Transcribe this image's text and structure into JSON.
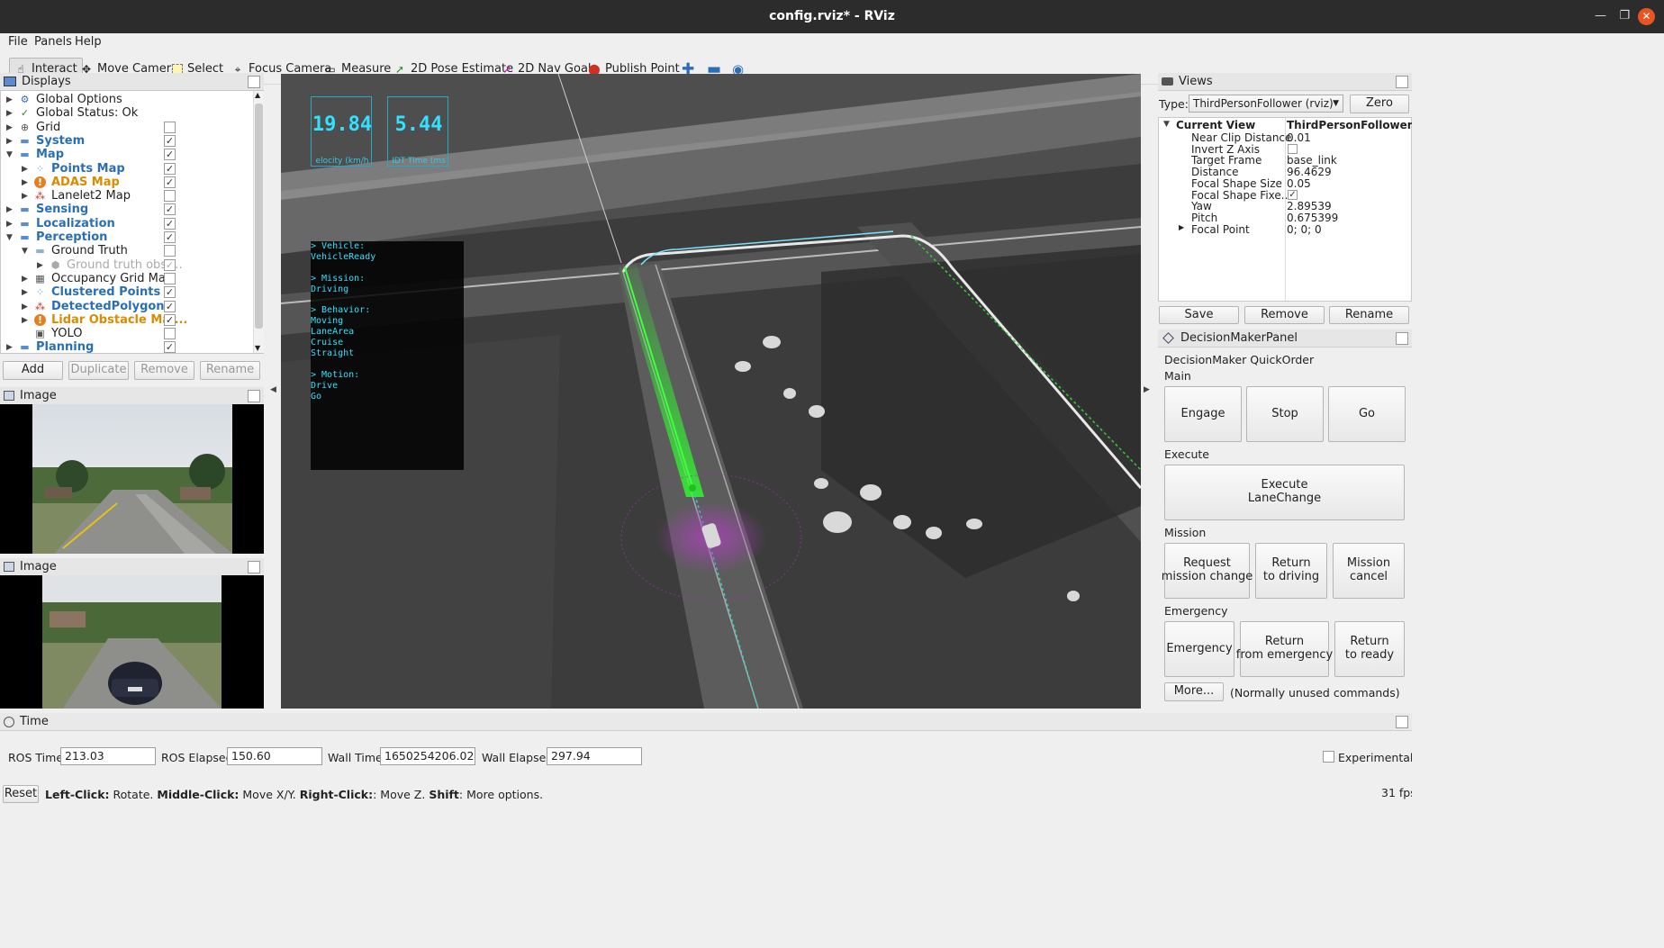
{
  "window": {
    "title": "config.rviz* - RViz"
  },
  "menu": [
    "File",
    "Panels",
    "Help"
  ],
  "toolbar": {
    "tools": [
      {
        "label": "Interact",
        "icon": "interact-icon"
      },
      {
        "label": "Move Camera",
        "icon": "move-camera-icon"
      },
      {
        "label": "Select",
        "icon": "select-icon"
      },
      {
        "label": "Focus Camera",
        "icon": "focus-camera-icon"
      },
      {
        "label": "Measure",
        "icon": "measure-icon"
      },
      {
        "label": "2D Pose Estimate",
        "icon": "pose-estimate-icon"
      },
      {
        "label": "2D Nav Goal",
        "icon": "nav-goal-icon"
      },
      {
        "label": "Publish Point",
        "icon": "publish-point-icon"
      }
    ]
  },
  "displays": {
    "title": "Displays",
    "items": [
      {
        "label": "Global Options"
      },
      {
        "label": "Global Status: Ok"
      },
      {
        "label": "Grid",
        "checked": false
      },
      {
        "label": "System",
        "checked": true
      },
      {
        "label": "Map",
        "checked": true
      },
      {
        "label": "Points Map",
        "checked": true
      },
      {
        "label": "ADAS Map",
        "checked": true
      },
      {
        "label": "Lanelet2 Map",
        "checked": false
      },
      {
        "label": "Sensing",
        "checked": true
      },
      {
        "label": "Localization",
        "checked": true
      },
      {
        "label": "Perception",
        "checked": true
      },
      {
        "label": "Ground Truth",
        "checked": false
      },
      {
        "label": "Ground truth obst...",
        "checked": true
      },
      {
        "label": "Occupancy Grid Map",
        "checked": false
      },
      {
        "label": "Clustered Points",
        "checked": true
      },
      {
        "label": "DetectedPolygons",
        "checked": true
      },
      {
        "label": "Lidar Obstacle Mar...",
        "checked": true
      },
      {
        "label": "YOLO",
        "checked": false
      },
      {
        "label": "Planning",
        "checked": true
      }
    ],
    "buttons": {
      "add": "Add",
      "duplicate": "Duplicate",
      "remove": "Remove",
      "rename": "Rename"
    }
  },
  "image_panels": [
    {
      "title": "Image"
    },
    {
      "title": "Image"
    }
  ],
  "overlay": {
    "velocity_value": "19.84",
    "velocity_label": "elocity (km/h",
    "time_value": "5.44",
    "time_label": "IDT Time (ms",
    "state_lines": [
      "> Vehicle:",
      "VehicleReady",
      "",
      "> Mission:",
      "Driving",
      "",
      "> Behavior:",
      "Moving",
      "LaneArea",
      "Cruise",
      "Straight",
      "",
      "> Motion:",
      "Drive",
      "Go"
    ]
  },
  "views": {
    "title": "Views",
    "type_label": "Type:",
    "type_value": "ThirdPersonFollower (rviz)",
    "zero": "Zero",
    "current_view_label": "Current View",
    "current_view_value": "ThirdPersonFollower ...",
    "props": [
      {
        "k": "Near Clip Distance",
        "v": "0.01"
      },
      {
        "k": "Invert Z Axis",
        "v": "",
        "checkbox": false
      },
      {
        "k": "Target Frame",
        "v": "base_link"
      },
      {
        "k": "Distance",
        "v": "96.4629"
      },
      {
        "k": "Focal Shape Size",
        "v": "0.05"
      },
      {
        "k": "Focal Shape Fixe...",
        "v": "",
        "checkbox": true
      },
      {
        "k": "Yaw",
        "v": "2.89539"
      },
      {
        "k": "Pitch",
        "v": "0.675399"
      },
      {
        "k": "Focal Point",
        "v": "0; 0; 0"
      }
    ],
    "buttons": {
      "save": "Save",
      "remove": "Remove",
      "rename": "Rename"
    }
  },
  "decision": {
    "title": "DecisionMakerPanel",
    "subtitle": "DecisionMaker QuickOrder",
    "main_label": "Main",
    "engage": "Engage",
    "stop": "Stop",
    "go": "Go",
    "execute_label": "Execute",
    "execute_lanechange": "Execute\nLaneChange",
    "mission_label": "Mission",
    "request_mission_change": "Request\nmission change",
    "return_to_driving": "Return\nto driving",
    "mission_cancel": "Mission\ncancel",
    "emergency_label": "Emergency",
    "emergency": "Emergency",
    "return_from_emergency": "Return\nfrom emergency",
    "return_to_ready": "Return\nto ready",
    "more": "More...",
    "more_note": "(Normally unused commands)"
  },
  "time": {
    "title": "Time",
    "ros_time_label": "ROS Time:",
    "ros_time": "213.03",
    "ros_elapsed_label": "ROS Elapsed:",
    "ros_elapsed": "150.60",
    "wall_time_label": "Wall Time:",
    "wall_time": "1650254206.02",
    "wall_elapsed_label": "Wall Elapsed:",
    "wall_elapsed": "297.94",
    "experimental": "Experimental"
  },
  "statusbar": {
    "reset": "Reset",
    "hint_lclick": "Left-Click:",
    "hint_lclick_txt": " Rotate. ",
    "hint_mclick": "Middle-Click:",
    "hint_mclick_txt": " Move X/Y. ",
    "hint_rclick": "Right-Click:",
    "hint_rclick_txt": ": Move Z. ",
    "hint_shift": "Shift",
    "hint_shift_txt": ": More options.",
    "fps": "31 fps"
  }
}
